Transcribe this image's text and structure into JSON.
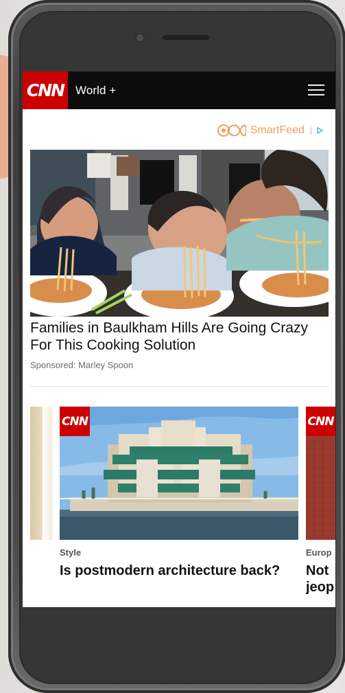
{
  "header": {
    "brand": "CNN",
    "section": "World +"
  },
  "ad": {
    "provider": "SmartFeed",
    "headline": "Families in Baulkham Hills Are Going Crazy For This Cooking Solution",
    "sponsored": "Sponsored: Marley Spoon"
  },
  "carousel": {
    "main": {
      "logo": "CNN",
      "category": "Style",
      "headline": "Is postmodern architecture back?"
    },
    "next": {
      "logo": "CNN",
      "category": "Europ",
      "headline": "Not jeop"
    }
  },
  "colors": {
    "cnn_red": "#cc0000",
    "smartfeed_orange": "#f39c61",
    "topbar_black": "#0c0c0c"
  },
  "icons": {
    "menu": "menu-icon",
    "smartfeed": "smartfeed-icon",
    "adchoices": "adchoices-icon"
  }
}
